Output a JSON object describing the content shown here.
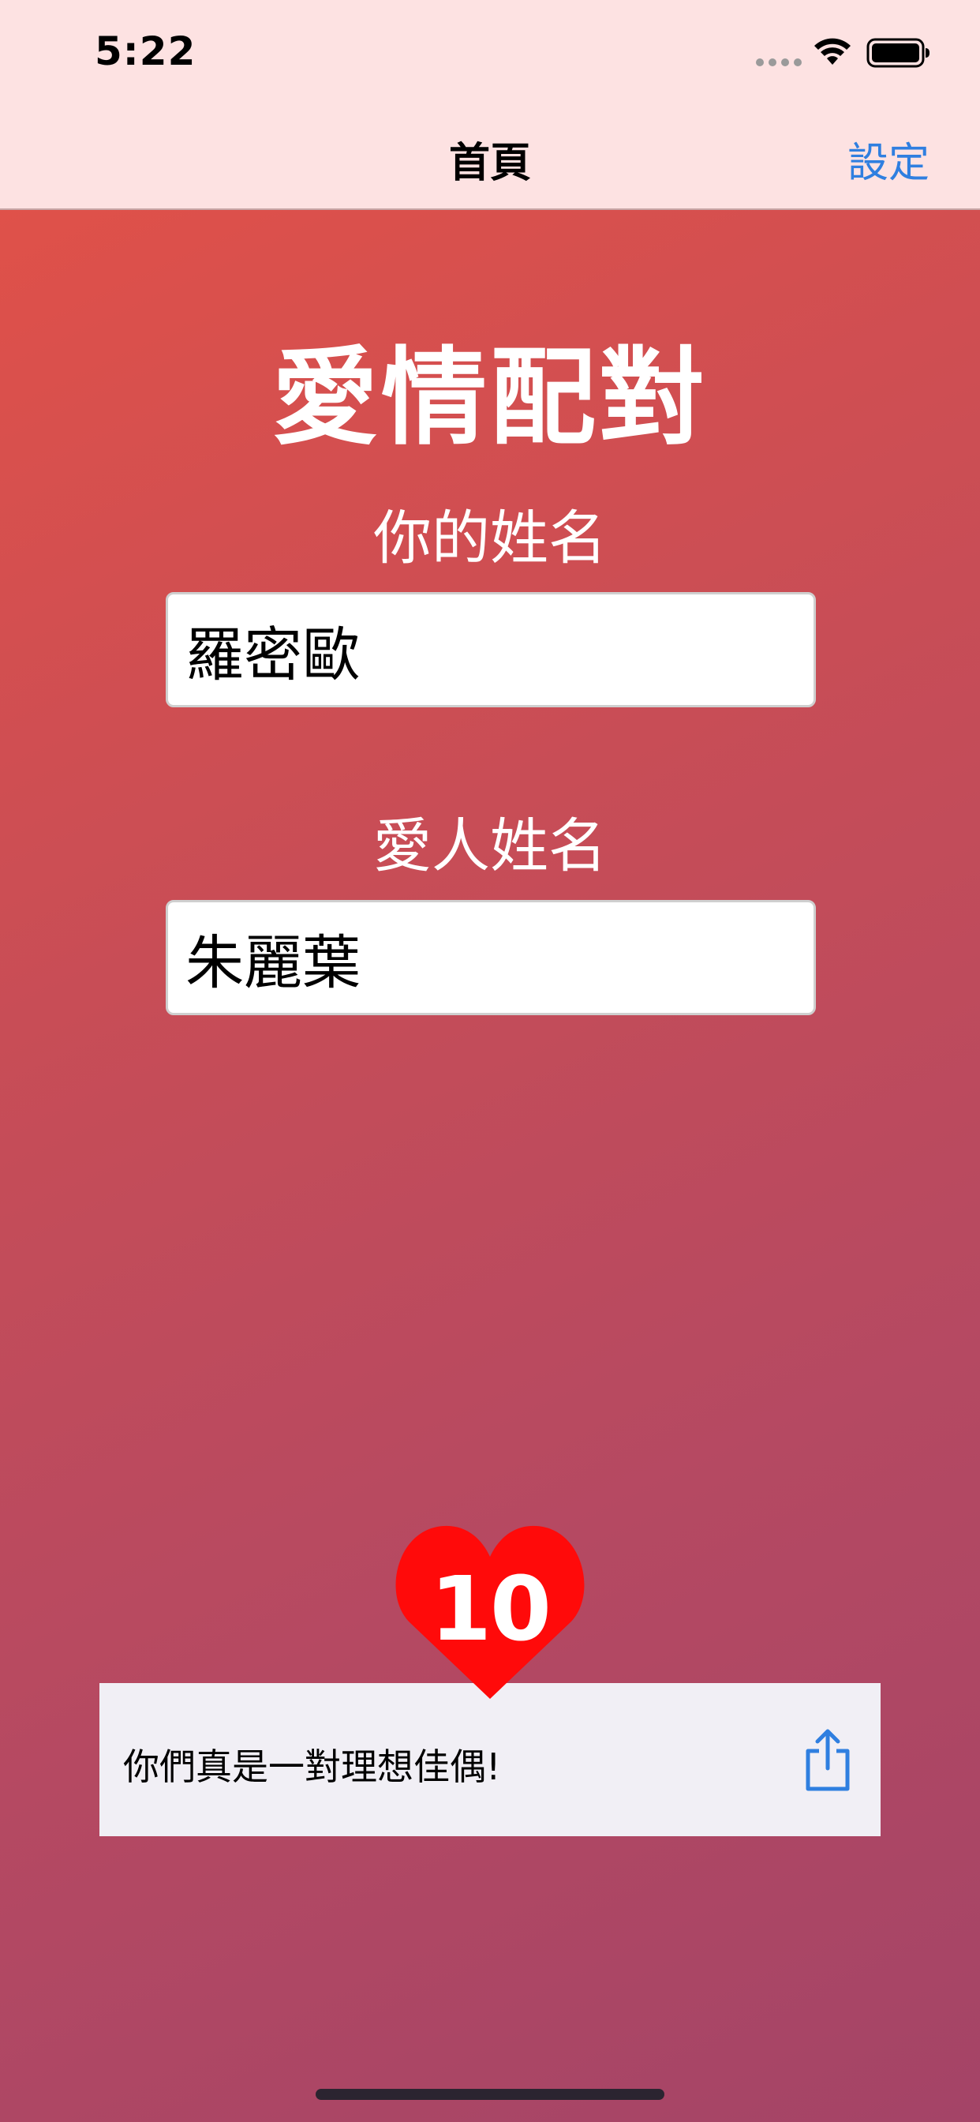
{
  "status_bar": {
    "time": "5:22"
  },
  "nav": {
    "title": "首頁",
    "settings_label": "設定"
  },
  "app": {
    "title": "愛情配對"
  },
  "form": {
    "your_name_label": "你的姓名",
    "your_name_value": "羅密歐",
    "lover_name_label": "愛人姓名",
    "lover_name_value": "朱麗葉"
  },
  "result": {
    "score": "10",
    "message": "你們真是一對理想佳偶!"
  },
  "icons": {
    "wifi": "wifi-icon",
    "battery": "battery-icon",
    "share": "share-icon",
    "heart": "heart-icon"
  },
  "colors": {
    "accent": "#2f7fe0",
    "heart": "#ff0a0a",
    "nav_background": "#fde2e2",
    "gradient_start": "#e55246",
    "gradient_end": "#a44467"
  }
}
